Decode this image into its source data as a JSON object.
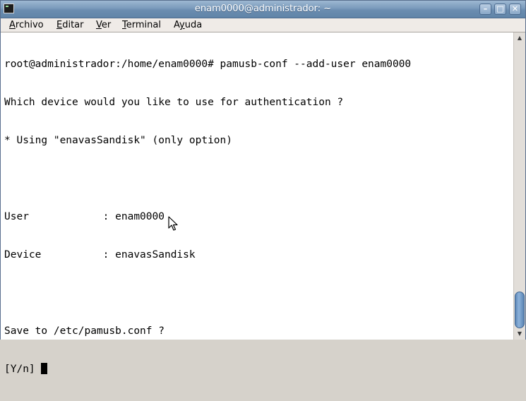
{
  "window": {
    "title": "enam0000@administrador: ~"
  },
  "menubar": {
    "items": [
      {
        "label": "Archivo",
        "mnemonic": "A",
        "rest": "rchivo"
      },
      {
        "label": "Editar",
        "mnemonic": "E",
        "rest": "ditar"
      },
      {
        "label": "Ver",
        "mnemonic": "V",
        "rest": "er"
      },
      {
        "label": "Terminal",
        "mnemonic": "T",
        "rest": "erminal"
      },
      {
        "label": "Ayuda",
        "mnemonic": "y",
        "pre": "A",
        "rest": "uda"
      }
    ]
  },
  "terminal": {
    "lines": [
      "root@administrador:/home/enam0000# pamusb-conf --add-user enam0000",
      "Which device would you like to use for authentication ?",
      "* Using \"enavasSandisk\" (only option)",
      "",
      "User            : enam0000",
      "Device          : enavasSandisk",
      "",
      "Save to /etc/pamusb.conf ?",
      "[Y/n] "
    ]
  },
  "icons": {
    "app": "terminal-icon",
    "minimize": "minimize-icon",
    "maximize": "maximize-icon",
    "close": "close-icon",
    "scroll_up": "arrow-up-icon",
    "scroll_down": "arrow-down-icon",
    "pointer": "mouse-pointer-icon"
  },
  "colors": {
    "titlebar": "#6b8db0",
    "scroll_thumb": "#6b95c6",
    "terminal_bg": "#ffffff",
    "terminal_fg": "#000000"
  }
}
